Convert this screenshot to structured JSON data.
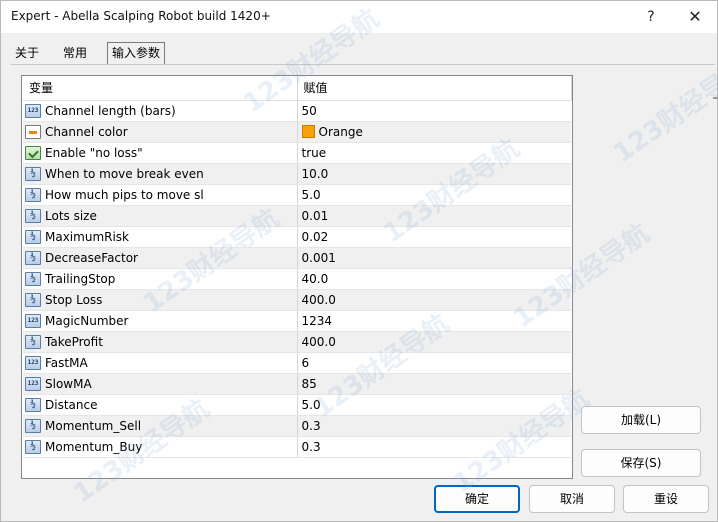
{
  "window": {
    "title": "Expert - Abella Scalping Robot build 1420+",
    "help_label": "?",
    "close_label": "✕"
  },
  "tabs": [
    {
      "label": "关于"
    },
    {
      "label": "常用"
    },
    {
      "label": "输入参数"
    }
  ],
  "active_tab": "输入参数",
  "grid": {
    "columns": [
      "变量",
      "赋值"
    ],
    "rows": [
      {
        "name": "Channel length (bars)",
        "value": "50",
        "type": "int",
        "icon": "int-icon"
      },
      {
        "name": "Channel color",
        "value": "Orange",
        "type": "color",
        "icon": "color-icon",
        "color": "#f7a20a"
      },
      {
        "name": "Enable \"no loss\"",
        "value": "true",
        "type": "bool",
        "icon": "bool-icon"
      },
      {
        "name": "When to move break even",
        "value": "10.0",
        "type": "double",
        "icon": "double-icon"
      },
      {
        "name": "How much pips to move sl",
        "value": "5.0",
        "type": "double",
        "icon": "double-icon"
      },
      {
        "name": "Lots size",
        "value": "0.01",
        "type": "double",
        "icon": "double-icon"
      },
      {
        "name": "MaximumRisk",
        "value": "0.02",
        "type": "double",
        "icon": "double-icon"
      },
      {
        "name": "DecreaseFactor",
        "value": "0.001",
        "type": "double",
        "icon": "double-icon"
      },
      {
        "name": "TrailingStop",
        "value": "40.0",
        "type": "double",
        "icon": "double-icon"
      },
      {
        "name": "Stop Loss",
        "value": "400.0",
        "type": "double",
        "icon": "double-icon"
      },
      {
        "name": "MagicNumber",
        "value": "1234",
        "type": "int",
        "icon": "int-icon"
      },
      {
        "name": "TakeProfit",
        "value": "400.0",
        "type": "double",
        "icon": "double-icon"
      },
      {
        "name": "FastMA",
        "value": "6",
        "type": "int",
        "icon": "int-icon"
      },
      {
        "name": "SlowMA",
        "value": "85",
        "type": "int",
        "icon": "int-icon"
      },
      {
        "name": "Distance",
        "value": "5.0",
        "type": "double",
        "icon": "double-icon"
      },
      {
        "name": "Momentum_Sell",
        "value": "0.3",
        "type": "double",
        "icon": "double-icon"
      },
      {
        "name": "Momentum_Buy",
        "value": "0.3",
        "type": "double",
        "icon": "double-icon"
      }
    ]
  },
  "buttons": {
    "load": "加载(L)",
    "save": "保存(S)",
    "ok": "确定",
    "cancel": "取消",
    "reset": "重设"
  },
  "watermark": "123财经导航",
  "colors": {
    "accent": "#0067c0",
    "alt_row": "#f0f0f0",
    "swatch_orange": "#f7a20a"
  }
}
